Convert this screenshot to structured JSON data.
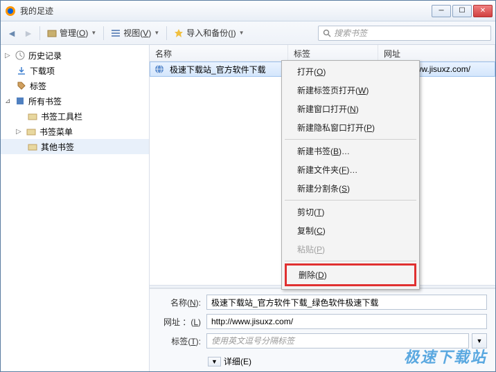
{
  "window": {
    "title": "我的足迹"
  },
  "toolbar": {
    "manage": {
      "label": "管理",
      "key": "O"
    },
    "view": {
      "label": "视图",
      "key": "V"
    },
    "import": {
      "label": "导入和备份",
      "key": "I"
    },
    "search_placeholder": "搜索书签"
  },
  "sidebar": {
    "history": "历史记录",
    "downloads": "下载项",
    "tags": "标签",
    "all_bookmarks": "所有书签",
    "toolbar_bookmarks": "书签工具栏",
    "menu_bookmarks": "书签菜单",
    "other_bookmarks": "其他书签"
  },
  "columns": {
    "name": "名称",
    "tags": "标签",
    "url": "网址"
  },
  "row": {
    "name": "极速下载站_官方软件下载",
    "url": "http://www.jisuxz.com/"
  },
  "context_menu": {
    "open": {
      "label": "打开",
      "key": "O"
    },
    "open_tab": {
      "label": "新建标签页打开",
      "key": "W"
    },
    "open_window": {
      "label": "新建窗口打开",
      "key": "N"
    },
    "open_private": {
      "label": "新建隐私窗口打开",
      "key": "P"
    },
    "new_bookmark": {
      "label": "新建书签",
      "key": "B",
      "suffix": "…"
    },
    "new_folder": {
      "label": "新建文件夹",
      "key": "F",
      "suffix": "…"
    },
    "new_separator": {
      "label": "新建分割条",
      "key": "S"
    },
    "cut": {
      "label": "剪切",
      "key": "T"
    },
    "copy": {
      "label": "复制",
      "key": "C"
    },
    "paste": {
      "label": "粘贴",
      "key": "P"
    },
    "delete": {
      "label": "删除",
      "key": "D"
    }
  },
  "details": {
    "name_label": {
      "label": "名称",
      "key": "N"
    },
    "name_value": "极速下载站_官方软件下载_绿色软件极速下载",
    "url_label": {
      "label": "网址 ：",
      "key": "L"
    },
    "url_value": "http://www.jisuxz.com/",
    "tags_label": {
      "label": "标签",
      "key": "T"
    },
    "tags_placeholder": "使用英文逗号分隔标签",
    "expand": {
      "label": "详细",
      "key": "E"
    }
  },
  "watermark": "极速下载站"
}
